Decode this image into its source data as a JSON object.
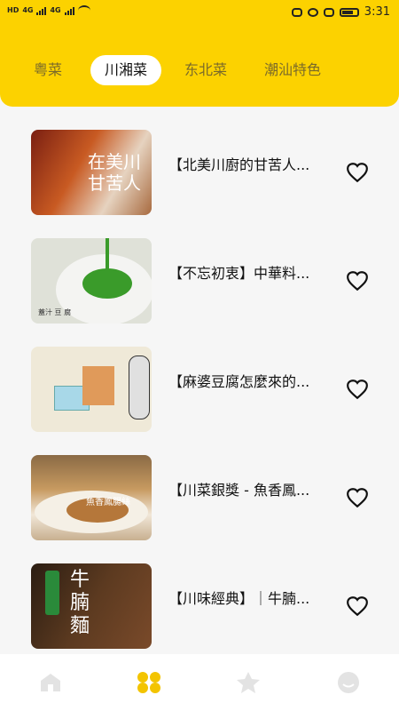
{
  "status_bar": {
    "left_labels": [
      "HD",
      "4G",
      "4G"
    ],
    "time": "3:31",
    "icons": [
      "hd-icon",
      "signal-icon",
      "wifi-icon",
      "eye-icon",
      "alarm-icon",
      "vibrate-icon",
      "battery-icon"
    ]
  },
  "tabs": [
    {
      "label": "粤菜",
      "active": false
    },
    {
      "label": "川湘菜",
      "active": true
    },
    {
      "label": "东北菜",
      "active": false
    },
    {
      "label": "潮汕特色",
      "active": false
    }
  ],
  "videos": [
    {
      "title": "【北美川廚的甘苦人...",
      "thumb_text": "在美川 甘苦人"
    },
    {
      "title": "【不忘初衷】中華料...",
      "thumb_text": "蓋汁 豆 腐"
    },
    {
      "title": "【麻婆豆腐怎麼來的...",
      "thumb_text": ""
    },
    {
      "title": "【川菜銀獎 - 魚香鳳...",
      "thumb_text": "魚香鳳腸絲"
    },
    {
      "title": "【川味經典】｜牛腩...",
      "thumb_text": "牛腩麵"
    }
  ],
  "bottom_nav": [
    {
      "icon": "home-icon",
      "active": false
    },
    {
      "icon": "category-icon",
      "active": true
    },
    {
      "icon": "star-icon",
      "active": false
    },
    {
      "icon": "profile-icon",
      "active": false
    }
  ],
  "colors": {
    "accent": "#fcd200",
    "inactive_icon": "#e3e3e3",
    "active_icon": "#f3c400"
  }
}
